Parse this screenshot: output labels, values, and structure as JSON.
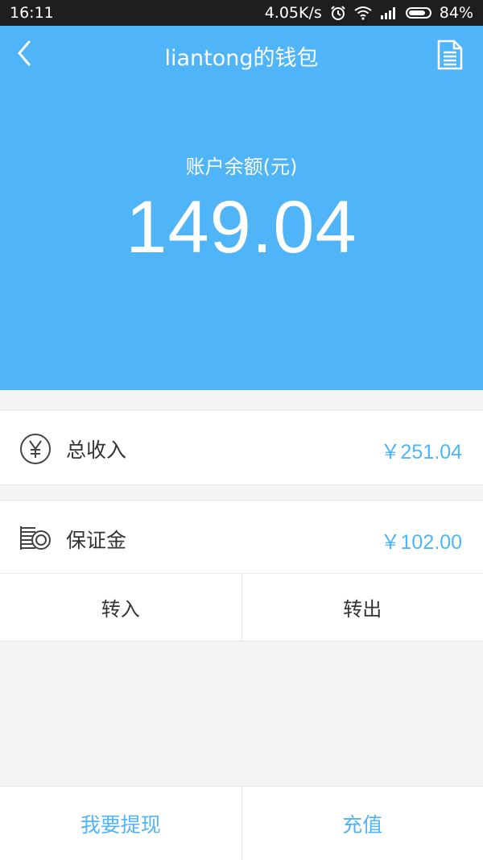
{
  "status_bar": {
    "time": "16:11",
    "speed": "4.05K/s",
    "battery": "84%"
  },
  "nav": {
    "title": "liantong的钱包"
  },
  "balance": {
    "label": "账户余额(元)",
    "value": "149.04"
  },
  "income": {
    "label": "总收入",
    "amount": "￥251.04",
    "icon": "yuan-circle-icon"
  },
  "deposit": {
    "label": "保证金",
    "amount": "￥102.00",
    "icon": "coins-stack-icon"
  },
  "transfer": {
    "in_label": "转入",
    "out_label": "转出"
  },
  "actions": {
    "withdraw_label": "我要提现",
    "recharge_label": "充值"
  },
  "colors": {
    "accent": "#4fb5f8",
    "status_bar": "#1e1e1e"
  }
}
